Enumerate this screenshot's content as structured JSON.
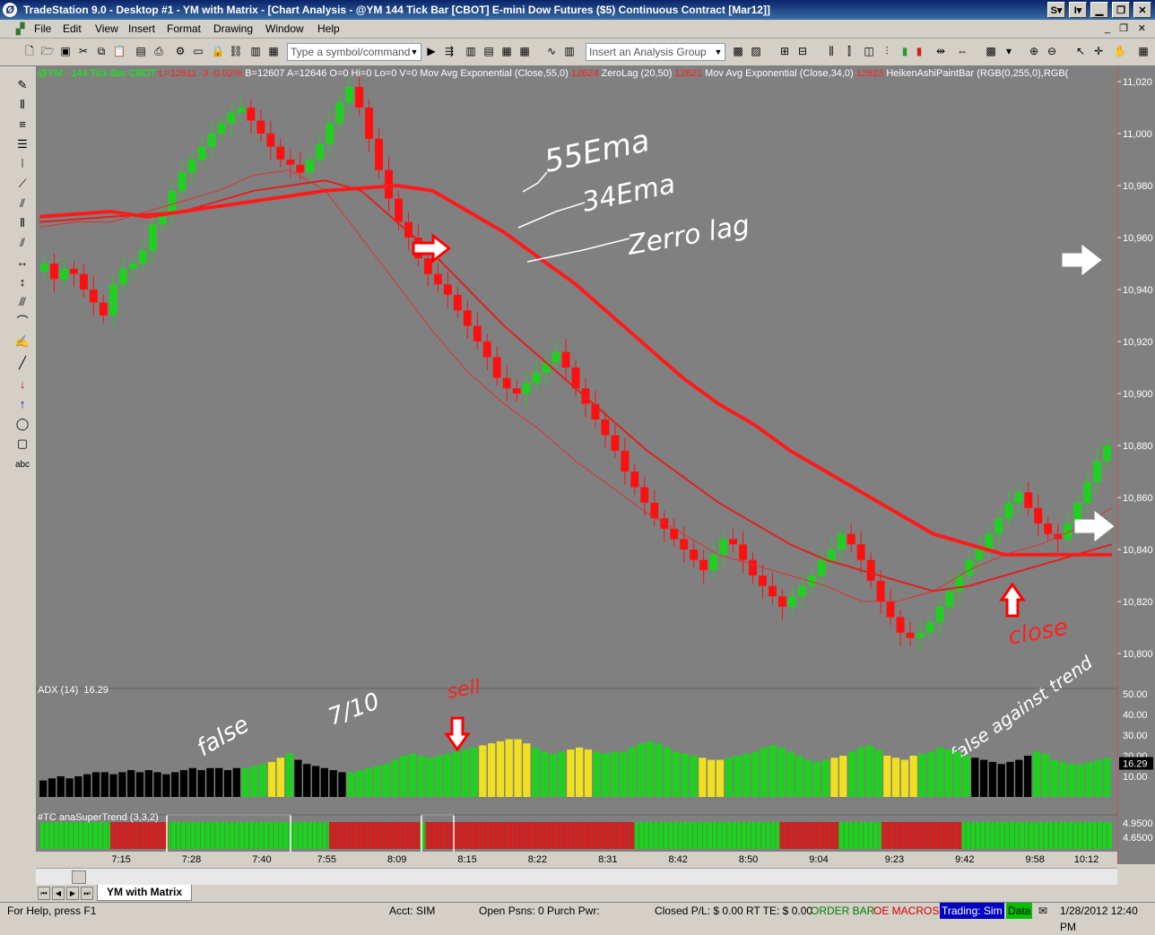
{
  "window": {
    "title": "TradeStation 9.0 - Desktop #1 - YM with Matrix - [Chart Analysis - @YM 144 Tick Bar [CBOT] E-mini Dow Futures ($5) Continuous Contract [Mar12]]",
    "app_icon": "Ø"
  },
  "menu": [
    "File",
    "Edit",
    "View",
    "Insert",
    "Format",
    "Drawing",
    "Window",
    "Help"
  ],
  "toolbar": {
    "symbol_placeholder": "Type a symbol/command",
    "analysis_placeholder": "Insert an Analysis Group"
  },
  "chart": {
    "info_line": {
      "symbol": "@YM - 144 Tick Bar  CBOT",
      "last": "L=12611  -3  -0.02%",
      "quote": "B=12607  A=12646  O=0  Hi=0  Lo=0  V=0  Mov Avg Exponential (Close,55,0)",
      "v1": "12624",
      "zl": "ZeroLag (20,50)",
      "v2": "12621",
      "ema34": "Mov Avg Exponential (Close,34,0)",
      "v3": "12623",
      "heiken": "HeikenAshiPaintBar (RGB(0,255,0),RGB("
    },
    "adx_label": "ADX (14)",
    "adx_value": "16.29",
    "supertrend_label": "#TC anaSuperTrend (3,3,2)",
    "annotations": {
      "ema55": "55Ema",
      "ema34": "34Ema",
      "zerolag": "Zerro lag",
      "close": "close",
      "false1": "false",
      "ten": "7/10",
      "sell": "sell",
      "false_against_trend": "false against trend"
    }
  },
  "chart_data": {
    "type": "candlestick",
    "y_ticks": [
      "11,020",
      "11,000",
      "10,980",
      "10,960",
      "10,940",
      "10,920",
      "10,900",
      "10,880",
      "10,860",
      "10,840",
      "10,820",
      "10,800"
    ],
    "x_ticks": [
      "7:15",
      "7:28",
      "7:40",
      "7:55",
      "8:09",
      "8:15",
      "8:22",
      "8:31",
      "8:42",
      "8:50",
      "9:04",
      "9:23",
      "9:42",
      "9:58",
      "10:12"
    ],
    "adx_ticks": [
      "50.00",
      "40.00",
      "30.00",
      "20.00",
      "10.00"
    ],
    "adx_current": "16.29",
    "supertrend_ticks": [
      "4.9500",
      "4.6500"
    ],
    "closes": [
      10950,
      10944,
      10948,
      10946,
      10940,
      10935,
      10930,
      10942,
      10948,
      10950,
      10955,
      10965,
      10970,
      10978,
      10985,
      10990,
      10995,
      11000,
      11004,
      11008,
      11010,
      11005,
      11000,
      10995,
      10990,
      10988,
      10985,
      10990,
      10996,
      11004,
      11012,
      11018,
      11010,
      10998,
      10986,
      10975,
      10966,
      10960,
      10952,
      10946,
      10942,
      10938,
      10932,
      10926,
      10920,
      10914,
      10906,
      10902,
      10900,
      10904,
      10908,
      10912,
      10916,
      10910,
      10902,
      10896,
      10890,
      10884,
      10878,
      10870,
      10864,
      10858,
      10852,
      10848,
      10844,
      10840,
      10836,
      10832,
      10838,
      10844,
      10842,
      10836,
      10830,
      10826,
      10822,
      10818,
      10822,
      10826,
      10830,
      10836,
      10840,
      10846,
      10842,
      10836,
      10828,
      10820,
      10814,
      10808,
      10806,
      10808,
      10812,
      10818,
      10824,
      10830,
      10836,
      10840,
      10846,
      10852,
      10858,
      10862,
      10856,
      10850,
      10846,
      10844,
      10850,
      10858,
      10866,
      10874,
      10880
    ],
    "ema55": [
      10968,
      10969,
      10970,
      10968,
      10970,
      10972,
      10974,
      10976,
      10978,
      10979,
      10980,
      10978,
      10970,
      10962,
      10952,
      10942,
      10930,
      10918,
      10906,
      10896,
      10888,
      10878,
      10870,
      10862,
      10854,
      10846,
      10842,
      10838,
      10838,
      10838,
      10838
    ],
    "ema34": [
      10966,
      10967,
      10968,
      10969,
      10970,
      10974,
      10978,
      10980,
      10982,
      10978,
      10966,
      10954,
      10940,
      10926,
      10914,
      10902,
      10890,
      10878,
      10868,
      10858,
      10850,
      10842,
      10836,
      10832,
      10828,
      10824,
      10826,
      10830,
      10834,
      10838,
      10842
    ],
    "zerolag": [
      10964,
      10966,
      10966,
      10970,
      10974,
      10978,
      10984,
      10986,
      10978,
      10960,
      10942,
      10924,
      10908,
      10896,
      10886,
      10874,
      10864,
      10854,
      10846,
      10838,
      10834,
      10830,
      10826,
      10820,
      10820,
      10824,
      10832,
      10838,
      10842,
      10848,
      10856
    ],
    "adx": [
      8,
      9,
      10,
      9,
      10,
      11,
      12,
      12,
      11,
      12,
      13,
      12,
      13,
      12,
      11,
      12,
      13,
      14,
      13,
      14,
      14,
      13,
      14,
      14,
      15,
      16,
      17,
      19,
      21,
      18,
      16,
      15,
      14,
      13,
      12,
      12,
      13,
      14,
      15,
      16,
      18,
      20,
      21,
      20,
      19,
      20,
      21,
      22,
      23,
      24,
      25,
      26,
      27,
      28,
      28,
      26,
      24,
      22,
      21,
      22,
      23,
      24,
      23,
      22,
      21,
      22,
      22,
      24,
      26,
      27,
      26,
      24,
      22,
      21,
      20,
      19,
      18,
      18,
      19,
      20,
      21,
      22,
      24,
      25,
      24,
      22,
      20,
      18,
      17,
      18,
      19,
      20,
      22,
      24,
      25,
      23,
      20,
      19,
      18,
      20,
      21,
      22,
      24,
      23,
      22,
      20,
      19,
      18,
      17,
      16,
      17,
      18,
      20,
      22,
      21,
      18,
      17,
      16,
      16,
      17,
      18,
      19
    ]
  }
}
